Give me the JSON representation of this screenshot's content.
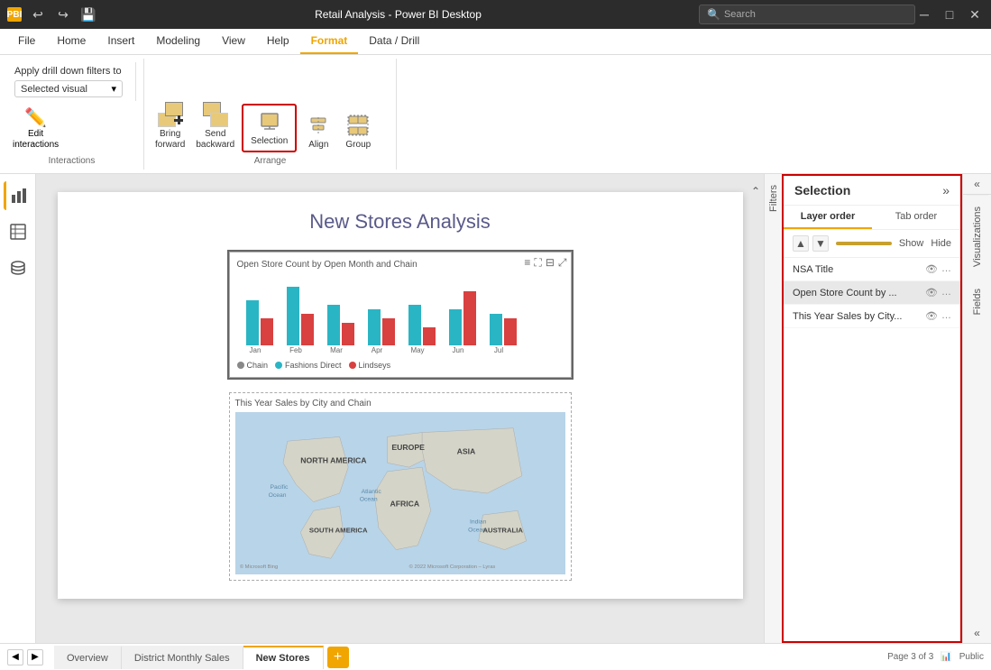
{
  "titleBar": {
    "title": "Retail Analysis - Power BI Desktop",
    "searchPlaceholder": "Search",
    "saveIcon": "💾",
    "undoIcon": "↩",
    "redoIcon": "↪"
  },
  "ribbon": {
    "tabs": [
      "File",
      "Home",
      "Insert",
      "Modeling",
      "View",
      "Help",
      "Format",
      "Data / Drill"
    ],
    "activeTab": "Format",
    "groups": {
      "interactions": {
        "label": "Interactions",
        "applyLabel": "Apply drill down filters to",
        "dropdownValue": "Selected visual",
        "editLabel": "Edit\ninteractions"
      },
      "arrange": {
        "label": "Arrange",
        "bringForward": "Bring\nforward",
        "sendBackward": "Send\nbackward",
        "selection": "Selection",
        "align": "Align",
        "group": "Group"
      }
    }
  },
  "selectionPanel": {
    "title": "Selection",
    "collapseBtn": "»",
    "tabs": [
      "Layer order",
      "Tab order"
    ],
    "showLabel": "Show",
    "hideLabel": "Hide",
    "items": [
      {
        "name": "NSA Title",
        "visible": true
      },
      {
        "name": "Open Store Count by ...",
        "visible": true,
        "active": true
      },
      {
        "name": "This Year Sales by City...",
        "visible": true
      }
    ]
  },
  "rightSidebar": {
    "tabs": [
      "Visualizations",
      "Fields"
    ],
    "collapseLeft": "«",
    "collapseRight": "«"
  },
  "filterSidebar": {
    "label": "Filters"
  },
  "canvas": {
    "pageTitle": "New Stores Analysis",
    "chartVisual": {
      "title": "Open Store Count by Open Month and Chain",
      "xLabels": [
        "Jan",
        "Feb",
        "Mar",
        "Apr",
        "May",
        "Jun",
        "Jul"
      ],
      "legend": [
        "Chain",
        "Fashions Direct",
        "Lindseys"
      ]
    },
    "mapVisual": {
      "title": "This Year Sales by City and Chain"
    }
  },
  "bottomBar": {
    "pageInfo": "Page 3 of 3",
    "publicLabel": "Public",
    "tabs": [
      "Overview",
      "District Monthly Sales",
      "New Stores"
    ],
    "activeTab": "New Stores",
    "addPageLabel": "+"
  }
}
